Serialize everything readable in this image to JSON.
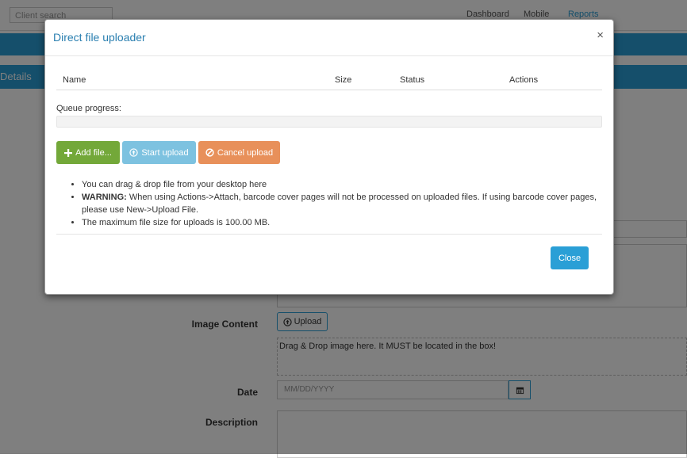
{
  "background": {
    "client_search_placeholder": "Client search",
    "nav_items": [
      "Dashboard",
      "Mobile",
      "Reports"
    ],
    "details_tab_label": "Details",
    "image_content_label": "Image Content",
    "upload_button_label": "Upload",
    "drop_zone_text": "Drag & Drop image here. It MUST be located in the box!",
    "date_label": "Date",
    "date_placeholder": "MM/DD/YYYY",
    "description_label": "Description"
  },
  "modal": {
    "title": "Direct file uploader",
    "close_x": "×",
    "table_headers": {
      "name": "Name",
      "size": "Size",
      "status": "Status",
      "actions": "Actions"
    },
    "queue_progress_label": "Queue progress:",
    "queue_progress_value": 0,
    "buttons": {
      "add": "Add file...",
      "start": "Start upload",
      "cancel": "Cancel upload"
    },
    "notes": {
      "item1": "You can drag & drop file from your desktop here",
      "warning_prefix": "WARNING:",
      "warning_text": " When using Actions->Attach, barcode cover pages will not be processed on uploaded files. If using barcode cover pages, please use New->Upload File.",
      "item3": "The maximum file size for uploads is 100.00 MB."
    },
    "footer_close": "Close"
  },
  "colors": {
    "accent": "#2a9fd6",
    "add_button": "#73a839",
    "start_button": "#7dc2e0",
    "cancel_button": "#e8905a"
  },
  "icons": {
    "add": "plus-icon",
    "start": "upload-circle-icon",
    "cancel": "ban-icon",
    "calendar": "calendar-icon",
    "upload": "upload-icon",
    "close": "close-icon"
  }
}
